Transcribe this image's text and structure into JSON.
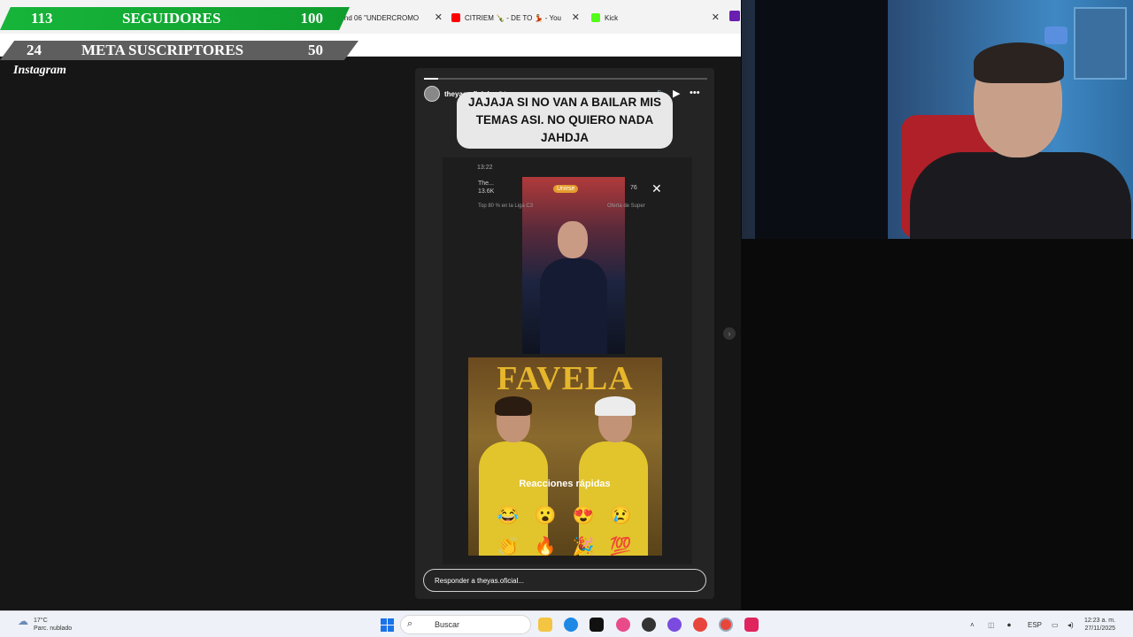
{
  "browser": {
    "tabs": [
      {
        "label": "ound 06 \"UNDERCROMO",
        "color": "#9aa0a6"
      },
      {
        "label": "CITRIEM 🍾 - DE TO 💃 - You",
        "color": "#ff0000"
      },
      {
        "label": "Kick",
        "color": "#53fc18"
      }
    ]
  },
  "overlay": {
    "followers": {
      "current": "113",
      "label": "SEGUIDORES",
      "goal": "100"
    },
    "subs": {
      "current": "24",
      "label": "META SUSCRIPTORES",
      "goal": "50"
    }
  },
  "instagram": {
    "logo": "Instagram",
    "story": {
      "username": "theyas.oficial",
      "time": "6 h",
      "progress": 0.05,
      "caption": "JAJAJA SI NO VAN A BAILAR MIS TEMAS ASI. NO QUIERO NADA JAHDJA",
      "phone_time": "13:22",
      "live_info": "The...",
      "live_viewers": "13.6K",
      "live_badge": "Unirse",
      "live_count": "76",
      "live_sub": "Top 80 % en la Liga C3",
      "live_offer": "Oferta de Super",
      "poster_title": "FAVELA",
      "reactions_title": "Reacciones rápidas",
      "reactions": [
        "😂",
        "😮",
        "😍",
        "😢",
        "👏",
        "🔥",
        "🎉",
        "💯"
      ],
      "reply_placeholder": "Responder a theyas.oficial..."
    }
  },
  "taskbar": {
    "weather_temp": "17°C",
    "weather_desc": "Parc. nublado",
    "search_placeholder": "Buscar",
    "lang": "ESP",
    "time": "12:23 a. m.",
    "date": "27/11/2025"
  }
}
